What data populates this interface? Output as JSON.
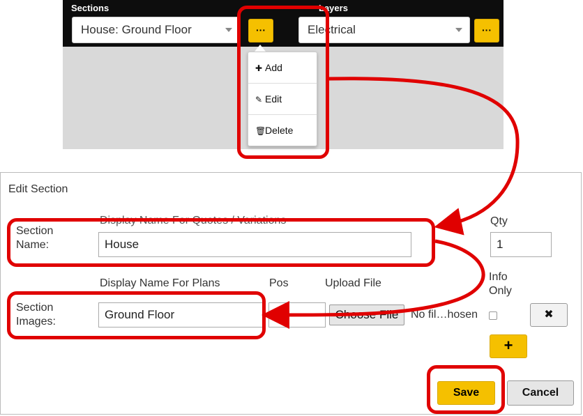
{
  "toolbar": {
    "sections_label": "Sections",
    "sections_value": "House: Ground Floor",
    "sections_more_label": "···",
    "layers_label": "Layers",
    "layers_value": "Electrical",
    "layers_more_label": "···"
  },
  "menu": {
    "items": [
      {
        "icon": "plus-icon",
        "glyph": "✚",
        "label": "Add"
      },
      {
        "icon": "pencil-icon",
        "glyph": "✎",
        "label": "Edit"
      },
      {
        "icon": "trash-icon",
        "glyph": "🗑",
        "label": "Delete"
      }
    ]
  },
  "dialog": {
    "title": "Edit Section",
    "section_name_label": "Section Name:",
    "display_name_quotes_header": "Display Name For Quotes / Variations",
    "section_name_value": "House",
    "qty_header": "Qty",
    "qty_value": "1",
    "display_name_plans_header": "Display Name For Plans",
    "pos_header": "Pos",
    "upload_header": "Upload File",
    "info_only_header": "Info Only",
    "section_images_label": "Section Images:",
    "section_image_name_value": "Ground Floor",
    "choose_file_label": "Choose File",
    "no_file_text": "No fil…hosen",
    "remove_label": "✖",
    "add_label": "+",
    "save_label": "Save",
    "cancel_label": "Cancel"
  },
  "colors": {
    "accent_yellow": "#f5c000",
    "annotation_red": "#e00000",
    "toolbar_black": "#0d0d0d"
  }
}
